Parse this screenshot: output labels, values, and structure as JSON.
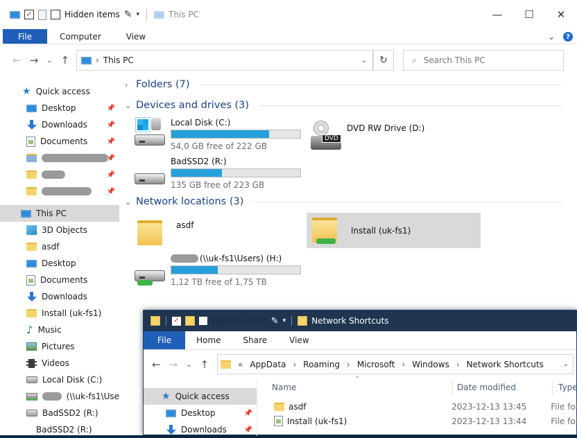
{
  "win1": {
    "quick_access": {
      "hidden_items": "Hidden items",
      "title": "This PC"
    },
    "ribbon": {
      "file": "File",
      "computer": "Computer",
      "view": "View"
    },
    "address": {
      "location": "This PC"
    },
    "search": {
      "placeholder": "Search This PC"
    },
    "nav": {
      "quick_access": "Quick access",
      "qa_items": [
        "Desktop",
        "Downloads",
        "Documents"
      ],
      "this_pc": "This PC",
      "pc_items": [
        "3D Objects",
        "asdf",
        "Desktop",
        "Documents",
        "Downloads",
        "Install (uk-fs1)",
        "Music",
        "Pictures",
        "Videos",
        "Local Disk (C:)",
        "(\\\\uk-fs1\\Use",
        "BadSSD2 (R:)",
        "BadSSD2 (R:)"
      ]
    },
    "groups": {
      "folders": "Folders (7)",
      "devices": "Devices and drives (3)",
      "network": "Network locations (3)"
    },
    "drives": [
      {
        "name": "Local Disk (C:)",
        "free": "54,0 GB free of 222 GB",
        "used_fraction": 0.757
      },
      {
        "name": "BadSSD2 (R:)",
        "free": "135 GB free of 223 GB",
        "used_fraction": 0.395
      },
      {
        "name": "DVD RW Drive (D:)",
        "label": "DVD"
      }
    ],
    "network_items": [
      {
        "name": "asdf"
      },
      {
        "name": "Install (uk-fs1)"
      },
      {
        "name": "(\\\\uk-fs1\\Users) (H:)",
        "free": "1,12 TB free of 1,75 TB",
        "used_fraction": 0.36
      }
    ]
  },
  "win2": {
    "title": "Network Shortcuts",
    "hidden_items": "Hidden items",
    "ribbon": {
      "file": "File",
      "home": "Home",
      "share": "Share",
      "view": "View"
    },
    "breadcrumb": [
      "AppData",
      "Roaming",
      "Microsoft",
      "Windows",
      "Network Shortcuts"
    ],
    "nav": {
      "quick_access": "Quick access",
      "items": [
        "Desktop",
        "Downloads"
      ]
    },
    "columns": {
      "name": "Name",
      "date": "Date modified",
      "type": "Type"
    },
    "rows": [
      {
        "name": "asdf",
        "date": "2023-12-13 13:45",
        "type": "File fol"
      },
      {
        "name": "Install (uk-fs1)",
        "date": "2023-12-13 13:44",
        "type": "File fol"
      }
    ]
  },
  "colors": {
    "accent": "#1f5fb8",
    "bar": "#26a0da",
    "folder": "#f7d46b"
  }
}
